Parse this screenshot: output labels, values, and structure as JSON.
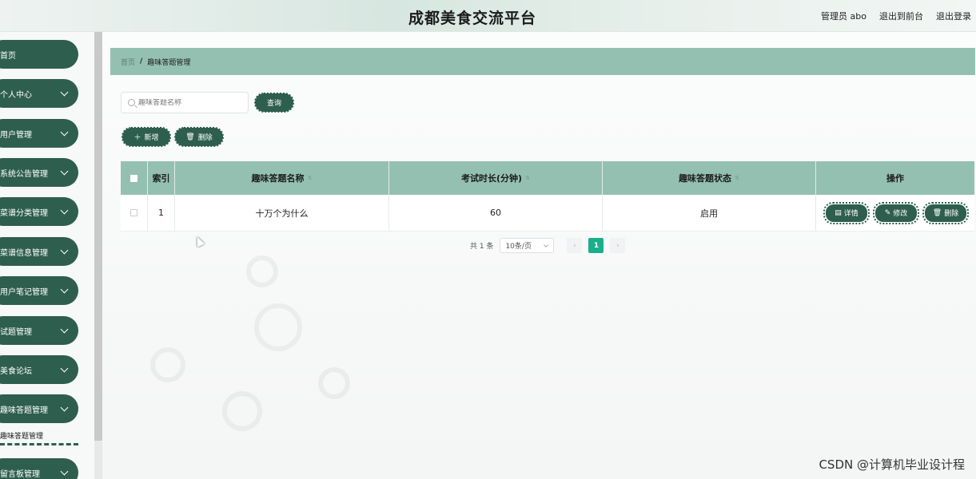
{
  "header": {
    "title": "成都美食交流平台",
    "user_label": "管理员 abo",
    "front_link": "退出到前台",
    "logout_link": "退出登录"
  },
  "sidebar": {
    "items": [
      {
        "label": "首页",
        "has_chevron": false
      },
      {
        "label": "个人中心",
        "has_chevron": true
      },
      {
        "label": "用户管理",
        "has_chevron": true
      },
      {
        "label": "系统公告管理",
        "has_chevron": true
      },
      {
        "label": "菜谱分类管理",
        "has_chevron": true
      },
      {
        "label": "菜谱信息管理",
        "has_chevron": true
      },
      {
        "label": "用户笔记管理",
        "has_chevron": true
      },
      {
        "label": "试题管理",
        "has_chevron": true
      },
      {
        "label": "美食论坛",
        "has_chevron": true
      },
      {
        "label": "趣味答题管理",
        "has_chevron": true
      },
      {
        "label": "留言板管理",
        "has_chevron": true
      }
    ],
    "active_submenu": "趣味答题管理"
  },
  "breadcrumb": {
    "home": "首页",
    "separator": "/",
    "current": "趣味答题管理"
  },
  "search": {
    "placeholder": "趣味答题名称",
    "value": "",
    "button_label": "查询"
  },
  "actions": {
    "add_label": "新增",
    "delete_label": "删除"
  },
  "table": {
    "columns": [
      "索引",
      "趣味答题名称",
      "考试时长(分钟)",
      "趣味答题状态",
      "操作"
    ],
    "rows": [
      {
        "index": "1",
        "name": "十万个为什么",
        "duration": "60",
        "status": "启用"
      }
    ],
    "row_actions": {
      "detail": "详情",
      "edit": "修改",
      "delete": "删除"
    }
  },
  "pagination": {
    "total_text": "共 1 条",
    "page_size": "10条/页",
    "current_page": "1",
    "prev": "‹",
    "next": "›"
  },
  "watermark": "CSDN @计算机毕业设计程",
  "colors": {
    "primary": "#2e5e4e",
    "header_band": "#94c0b2",
    "pager_active": "#1aaf8c"
  }
}
